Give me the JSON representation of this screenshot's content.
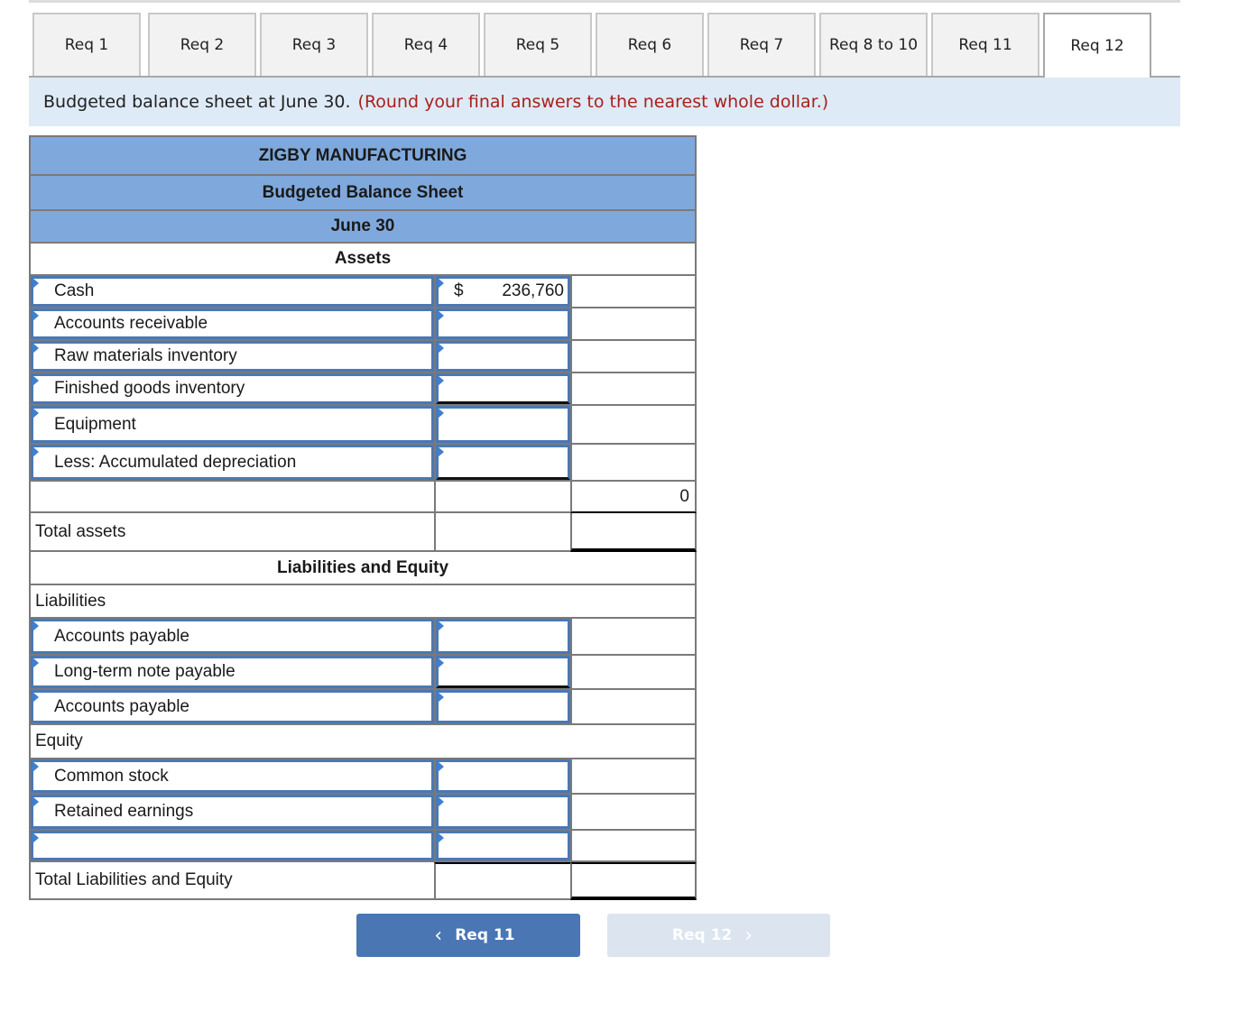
{
  "tabs": [
    {
      "label": "Req 1",
      "active": false
    },
    {
      "label": "Req 2",
      "active": false
    },
    {
      "label": "Req 3",
      "active": false
    },
    {
      "label": "Req 4",
      "active": false
    },
    {
      "label": "Req 5",
      "active": false
    },
    {
      "label": "Req 6",
      "active": false
    },
    {
      "label": "Req 7",
      "active": false
    },
    {
      "label": "Req 8 to 10",
      "active": false
    },
    {
      "label": "Req 11",
      "active": false
    },
    {
      "label": "Req 12",
      "active": true
    }
  ],
  "instruction": {
    "text": "Budgeted balance sheet at June 30.",
    "hint": "(Round your final answers to the nearest whole dollar.)"
  },
  "sheet": {
    "company": "ZIGBY MANUFACTURING",
    "title": "Budgeted Balance Sheet",
    "date": "June 30",
    "assets_heading": "Assets",
    "assets": [
      {
        "label": "Cash",
        "currency": "$",
        "value": "236,760"
      },
      {
        "label": "Accounts receivable",
        "currency": "",
        "value": ""
      },
      {
        "label": "Raw materials inventory",
        "currency": "",
        "value": ""
      },
      {
        "label": "Finished goods inventory",
        "currency": "",
        "value": ""
      },
      {
        "label": "Equipment",
        "currency": "",
        "value": ""
      },
      {
        "label": "Less: Accumulated depreciation",
        "currency": "",
        "value": ""
      }
    ],
    "assets_subtotal": {
      "label": "",
      "col2": "",
      "col3": "0"
    },
    "total_assets": {
      "label": "Total assets",
      "col2": "",
      "col3": ""
    },
    "liab_equity_heading": "Liabilities and Equity",
    "liabilities_label": "Liabilities",
    "liabilities": [
      {
        "label": "Accounts payable",
        "value": ""
      },
      {
        "label": "Long-term note payable",
        "value": ""
      },
      {
        "label": "Accounts payable",
        "value": ""
      }
    ],
    "equity_label": "Equity",
    "equity": [
      {
        "label": "Common stock",
        "value": ""
      },
      {
        "label": "Retained earnings",
        "value": ""
      },
      {
        "label": "",
        "value": ""
      }
    ],
    "total_liab_equity": {
      "label": "Total Liabilities and Equity",
      "col2": "",
      "col3": ""
    }
  },
  "nav": {
    "prev_label": "Req 11",
    "next_label": "Req 12",
    "prev_icon": "chevron-left-icon",
    "next_icon": "chevron-right-icon",
    "prev_glyph": "‹",
    "next_glyph": "›"
  },
  "colors": {
    "header_blue": "#7fa9dc",
    "input_border": "#4a78b4",
    "instruction_bg": "#deeaf6",
    "hint_red": "#a8201a",
    "prev_button": "#4a76b4",
    "next_button_disabled": "#dbe4ef"
  }
}
